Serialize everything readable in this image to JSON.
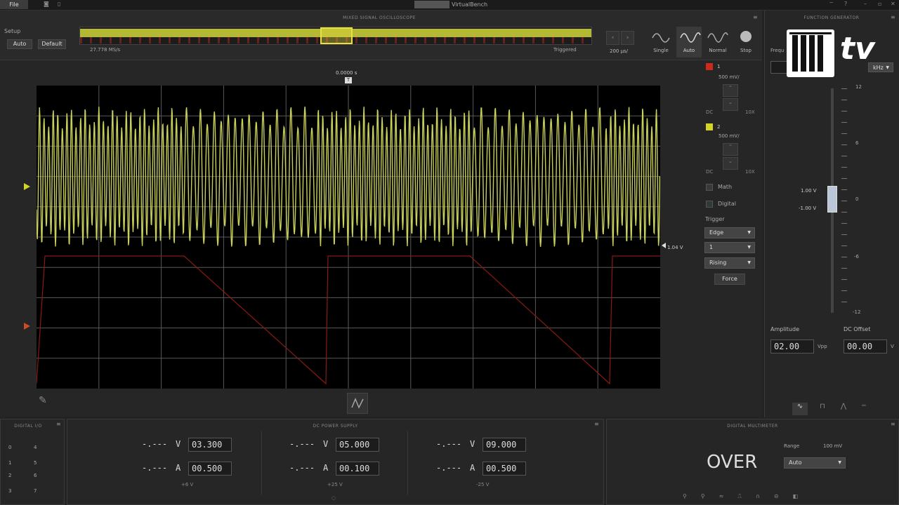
{
  "app": {
    "title": "VirtualBench",
    "file_menu": "File"
  },
  "scope": {
    "header": "MIXED SIGNAL OSCILLOSCOPE",
    "setup_label": "Setup",
    "auto_label": "Auto",
    "default_label": "Default",
    "sample_rate": "27.778 MS/s",
    "status": "Triggered",
    "timebase": "200 µs/",
    "modes": [
      "Single",
      "Auto",
      "Normal",
      "Stop"
    ],
    "trigger_time": "0.0000 s",
    "trigger_level": "1.04 V",
    "channels": [
      {
        "num": "1",
        "scale": "500 mV/",
        "coupling_dc": "DC",
        "attenuation": "10X",
        "color": "#cc2a1a"
      },
      {
        "num": "2",
        "scale": "500 mV/",
        "coupling_dc": "DC",
        "attenuation": "10X",
        "color": "#d4d427"
      }
    ],
    "math_label": "Math",
    "digital_label": "Digital",
    "trigger": {
      "label": "Trigger",
      "type": "Edge",
      "source": "1",
      "slope": "Rising",
      "force_label": "Force"
    },
    "ch1_trace_color": "#8a1a14",
    "ch2_trace_color": "#c8cf5a"
  },
  "fgen": {
    "header": "FUNCTION GENERATOR",
    "frequency_label": "Frequ",
    "freq_unit": "kHz",
    "scale_ticks": [
      "12",
      "6",
      "0",
      "-6",
      "-12"
    ],
    "high_marker": "1.00 V",
    "low_marker": "-1.00 V",
    "amplitude_label": "Amplitude",
    "amplitude_value": "02.00",
    "amplitude_unit": "Vpp",
    "offset_label": "DC Offset",
    "offset_value": "00.00",
    "offset_unit": "V"
  },
  "logo": {
    "text": "tv"
  },
  "dio": {
    "header": "DIGITAL I/O",
    "pins_left": [
      "0",
      "1",
      "2",
      "3"
    ],
    "pins_right": [
      "4",
      "5",
      "6",
      "7"
    ]
  },
  "psu": {
    "header": "DC POWER SUPPLY",
    "channels": [
      {
        "v_read": "-.---",
        "v_unit": "V",
        "v_set": "03.300",
        "a_read": "-.---",
        "a_unit": "A",
        "a_set": "00.500",
        "label": "+6 V"
      },
      {
        "v_read": "-.---",
        "v_unit": "V",
        "v_set": "05.000",
        "a_read": "-.---",
        "a_unit": "A",
        "a_set": "00.100",
        "label": "+25 V"
      },
      {
        "v_read": "-.---",
        "v_unit": "V",
        "v_set": "09.000",
        "a_read": "-.---",
        "a_unit": "A",
        "a_set": "00.500",
        "label": "-25 V"
      }
    ]
  },
  "dmm": {
    "header": "DIGITAL MULTIMETER",
    "reading": "OVER",
    "range_label": "Range",
    "range_value": "100 mV",
    "range_mode": "Auto"
  }
}
